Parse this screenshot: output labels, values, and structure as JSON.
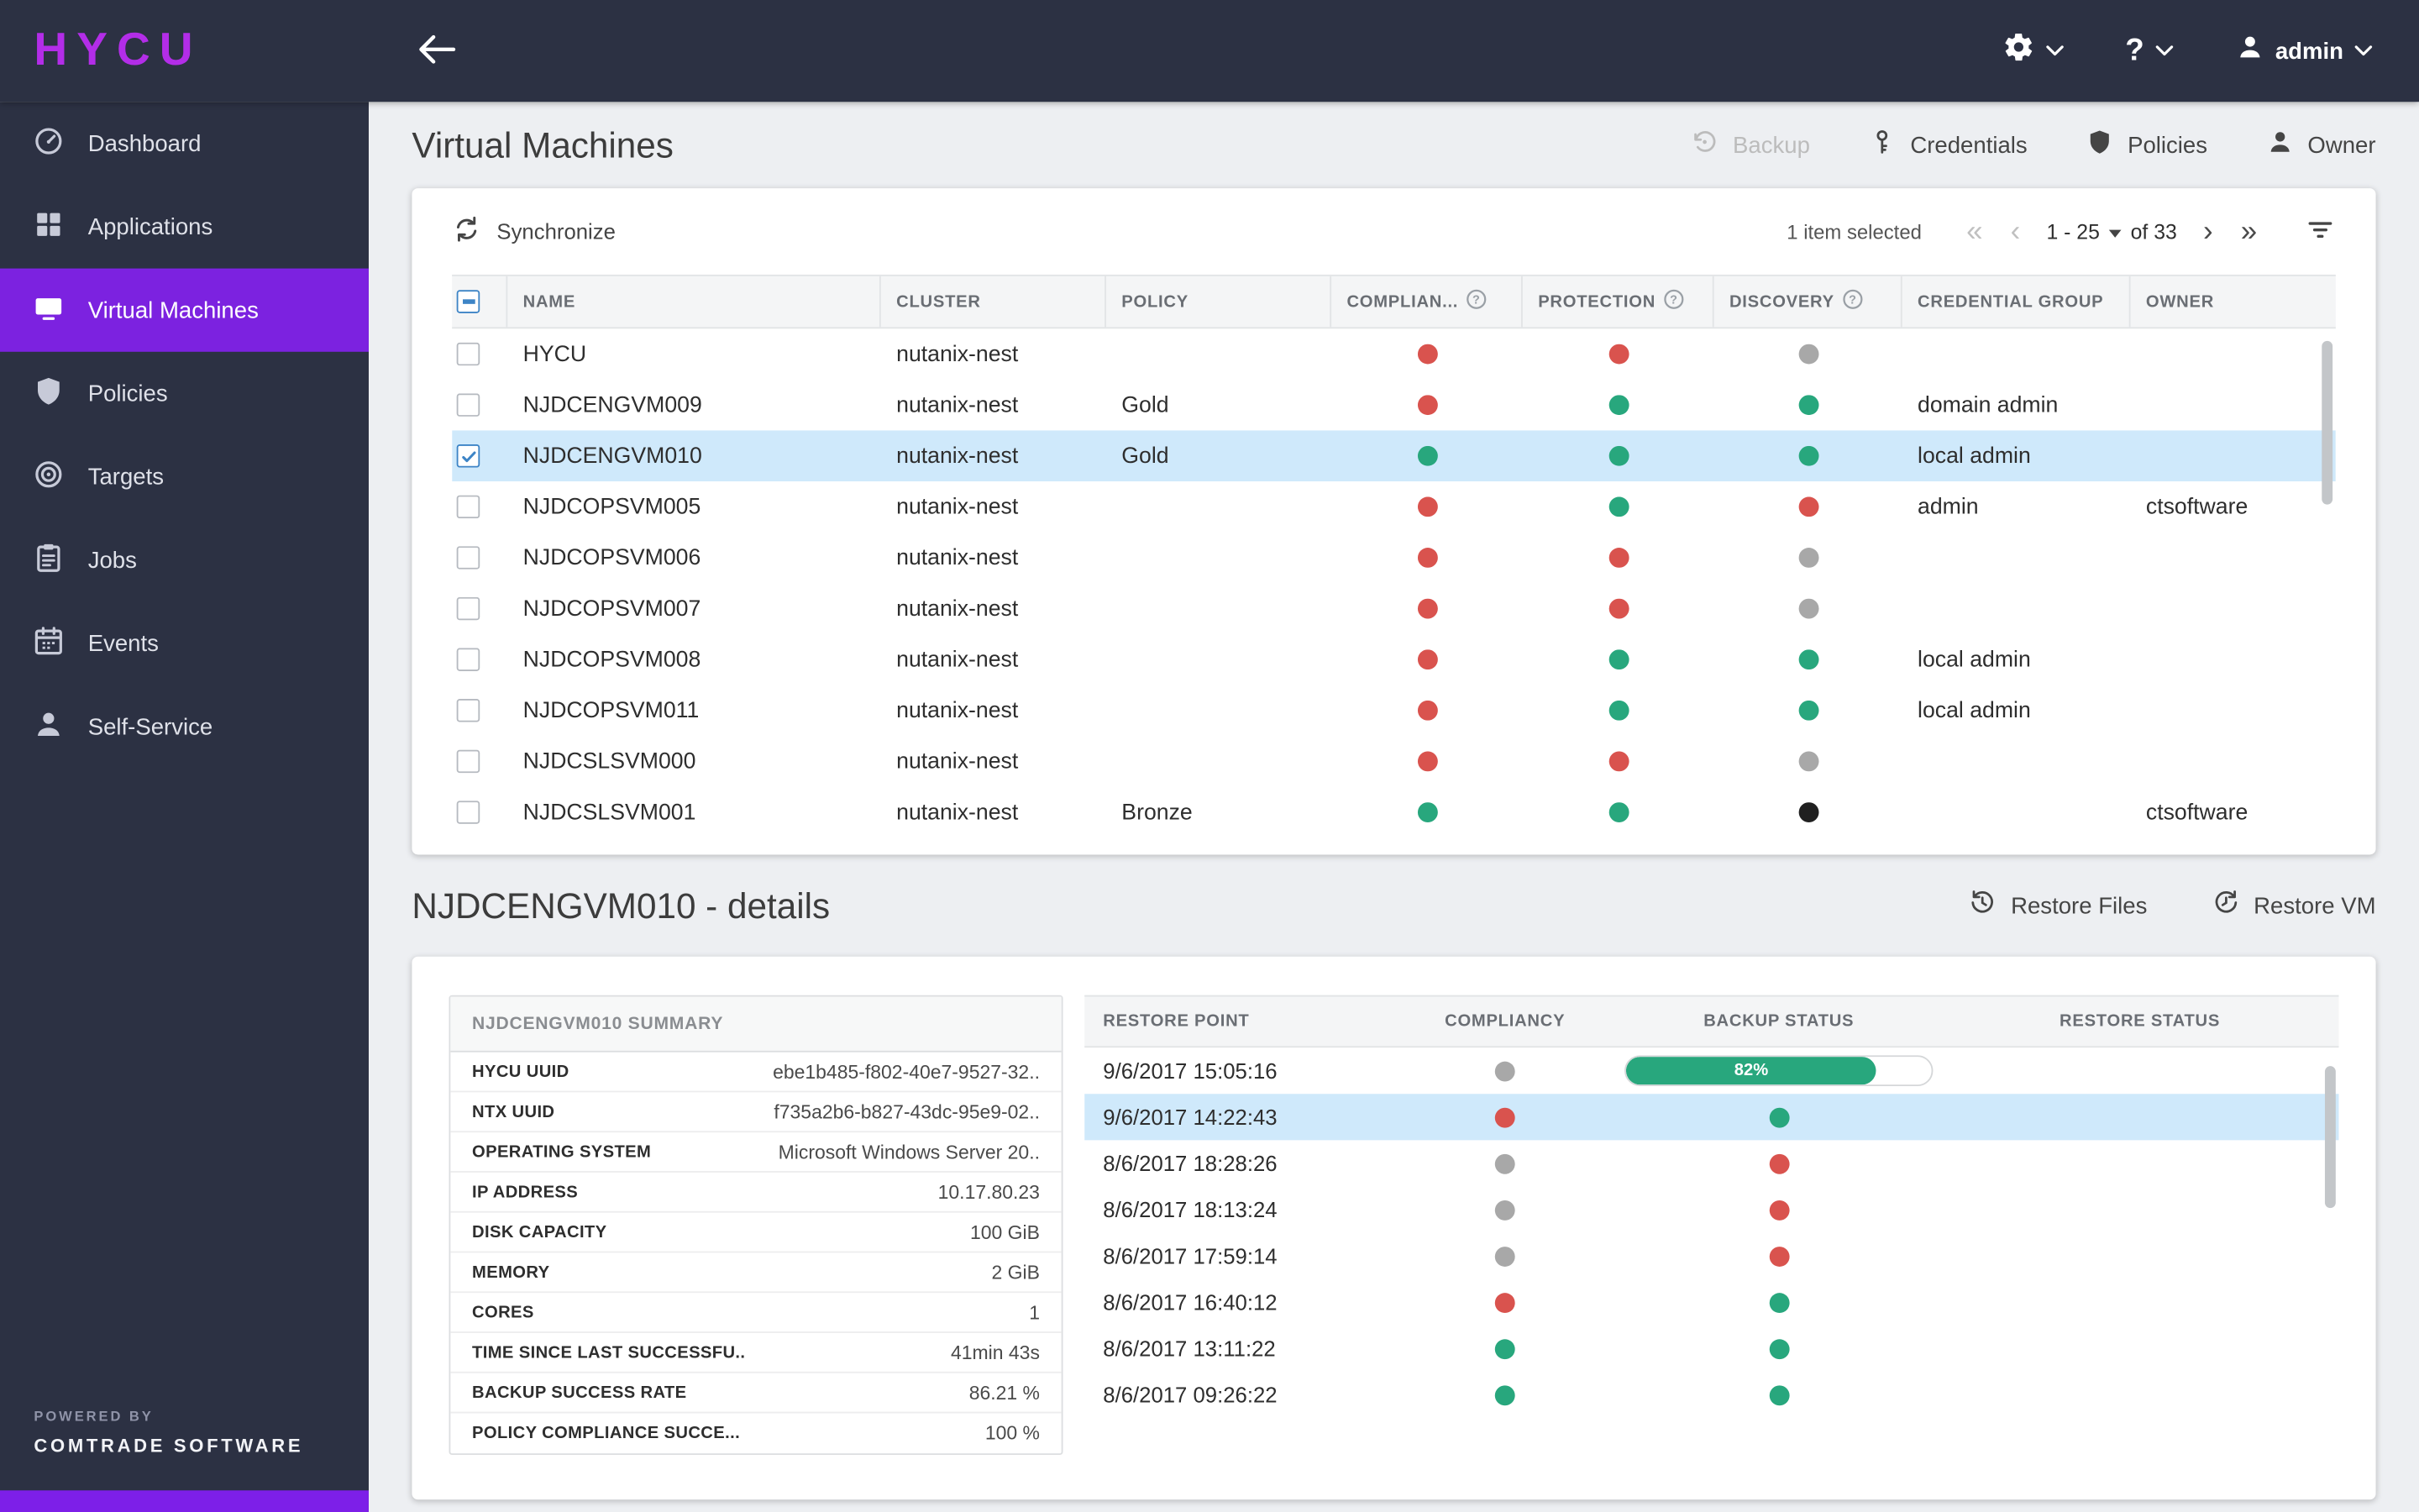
{
  "topbar": {
    "logo": "HYCU",
    "help_label": "?",
    "user": "admin"
  },
  "sidebar": {
    "items": [
      {
        "label": "Dashboard",
        "icon": "dashboard-gauge-icon",
        "active": false
      },
      {
        "label": "Applications",
        "icon": "grid-icon",
        "active": false
      },
      {
        "label": "Virtual Machines",
        "icon": "monitor-icon",
        "active": true
      },
      {
        "label": "Policies",
        "icon": "shield-icon",
        "active": false
      },
      {
        "label": "Targets",
        "icon": "target-icon",
        "active": false
      },
      {
        "label": "Jobs",
        "icon": "clipboard-icon",
        "active": false
      },
      {
        "label": "Events",
        "icon": "calendar-icon",
        "active": false
      },
      {
        "label": "Self-Service",
        "icon": "person-icon",
        "active": false
      }
    ],
    "powered_by": "POWERED BY",
    "company": "COMTRADE SOFTWARE"
  },
  "header": {
    "title": "Virtual Machines",
    "actions": {
      "backup": "Backup",
      "credentials": "Credentials",
      "policies": "Policies",
      "owner": "Owner"
    }
  },
  "vm_table": {
    "synchronize_label": "Synchronize",
    "selection_text": "1 item selected",
    "page_range": "1 - 25",
    "page_total": "of 33",
    "columns": [
      "NAME",
      "CLUSTER",
      "POLICY",
      "COMPLIAN...",
      "PROTECTION",
      "DISCOVERY",
      "CREDENTIAL GROUP",
      "OWNER"
    ],
    "rows": [
      {
        "name": "HYCU",
        "cluster": "nutanix-nest",
        "policy": "",
        "compliance": "red",
        "protection": "red",
        "discovery": "gray",
        "credential_group": "",
        "owner": "",
        "checked": false,
        "selected": false
      },
      {
        "name": "NJDCENGVM009",
        "cluster": "nutanix-nest",
        "policy": "Gold",
        "compliance": "red",
        "protection": "green",
        "discovery": "green",
        "credential_group": "domain admin",
        "owner": "",
        "checked": false,
        "selected": false
      },
      {
        "name": "NJDCENGVM010",
        "cluster": "nutanix-nest",
        "policy": "Gold",
        "compliance": "green",
        "protection": "green",
        "discovery": "green",
        "credential_group": "local admin",
        "owner": "",
        "checked": true,
        "selected": true
      },
      {
        "name": "NJDCOPSVM005",
        "cluster": "nutanix-nest",
        "policy": "",
        "compliance": "red",
        "protection": "green",
        "discovery": "red",
        "credential_group": "admin",
        "owner": "ctsoftware",
        "checked": false,
        "selected": false
      },
      {
        "name": "NJDCOPSVM006",
        "cluster": "nutanix-nest",
        "policy": "",
        "compliance": "red",
        "protection": "red",
        "discovery": "gray",
        "credential_group": "",
        "owner": "",
        "checked": false,
        "selected": false
      },
      {
        "name": "NJDCOPSVM007",
        "cluster": "nutanix-nest",
        "policy": "",
        "compliance": "red",
        "protection": "red",
        "discovery": "gray",
        "credential_group": "",
        "owner": "",
        "checked": false,
        "selected": false
      },
      {
        "name": "NJDCOPSVM008",
        "cluster": "nutanix-nest",
        "policy": "",
        "compliance": "red",
        "protection": "green",
        "discovery": "green",
        "credential_group": "local admin",
        "owner": "",
        "checked": false,
        "selected": false
      },
      {
        "name": "NJDCOPSVM011",
        "cluster": "nutanix-nest",
        "policy": "",
        "compliance": "red",
        "protection": "green",
        "discovery": "green",
        "credential_group": "local admin",
        "owner": "",
        "checked": false,
        "selected": false
      },
      {
        "name": "NJDCSLSVM000",
        "cluster": "nutanix-nest",
        "policy": "",
        "compliance": "red",
        "protection": "red",
        "discovery": "gray",
        "credential_group": "",
        "owner": "",
        "checked": false,
        "selected": false
      },
      {
        "name": "NJDCSLSVM001",
        "cluster": "nutanix-nest",
        "policy": "Bronze",
        "compliance": "green",
        "protection": "green",
        "discovery": "black",
        "credential_group": "",
        "owner": "ctsoftware",
        "checked": false,
        "selected": false
      }
    ]
  },
  "details": {
    "title": "NJDCENGVM010 - details",
    "restore_files_label": "Restore Files",
    "restore_vm_label": "Restore VM",
    "summary": {
      "title": "NJDCENGVM010 SUMMARY",
      "rows": [
        {
          "label": "HYCU UUID",
          "value": "ebe1b485-f802-40e7-9527-32.."
        },
        {
          "label": "NTX UUID",
          "value": "f735a2b6-b827-43dc-95e9-02.."
        },
        {
          "label": "OPERATING SYSTEM",
          "value": "Microsoft Windows Server 20.."
        },
        {
          "label": "IP ADDRESS",
          "value": "10.17.80.23"
        },
        {
          "label": "DISK CAPACITY",
          "value": "100 GiB"
        },
        {
          "label": "MEMORY",
          "value": "2 GiB"
        },
        {
          "label": "CORES",
          "value": "1"
        },
        {
          "label": "TIME SINCE LAST SUCCESSFU..",
          "value": "41min 43s"
        },
        {
          "label": "BACKUP SUCCESS RATE",
          "value": "86.21 %"
        },
        {
          "label": "POLICY COMPLIANCE SUCCE...",
          "value": "100 %"
        }
      ]
    },
    "restore_table": {
      "columns": [
        "RESTORE POINT",
        "COMPLIANCY",
        "BACKUP STATUS",
        "RESTORE STATUS"
      ],
      "rows": [
        {
          "time": "9/6/2017 15:05:16",
          "compliancy": "gray",
          "progress": 82,
          "progress_label": "82%",
          "selected": false
        },
        {
          "time": "9/6/2017 14:22:43",
          "compliancy": "red",
          "backup": "green",
          "selected": true
        },
        {
          "time": "8/6/2017 18:28:26",
          "compliancy": "gray",
          "backup": "red",
          "selected": false
        },
        {
          "time": "8/6/2017 18:13:24",
          "compliancy": "gray",
          "backup": "red",
          "selected": false
        },
        {
          "time": "8/6/2017 17:59:14",
          "compliancy": "gray",
          "backup": "red",
          "selected": false
        },
        {
          "time": "8/6/2017 16:40:12",
          "compliancy": "red",
          "backup": "green",
          "selected": false
        },
        {
          "time": "8/6/2017 13:11:22",
          "compliancy": "green",
          "backup": "green",
          "selected": false
        },
        {
          "time": "8/6/2017 09:26:22",
          "compliancy": "green",
          "backup": "green",
          "selected": false
        }
      ]
    }
  },
  "colors": {
    "accent": "#7c22e0",
    "chrome_bg": "#2c3143",
    "selected_row": "#cfe9fb",
    "progress_green": "#28a77d",
    "status": {
      "red": "#d9534e",
      "green": "#28a77d",
      "gray": "#a8a8a8",
      "black": "#202020"
    }
  }
}
